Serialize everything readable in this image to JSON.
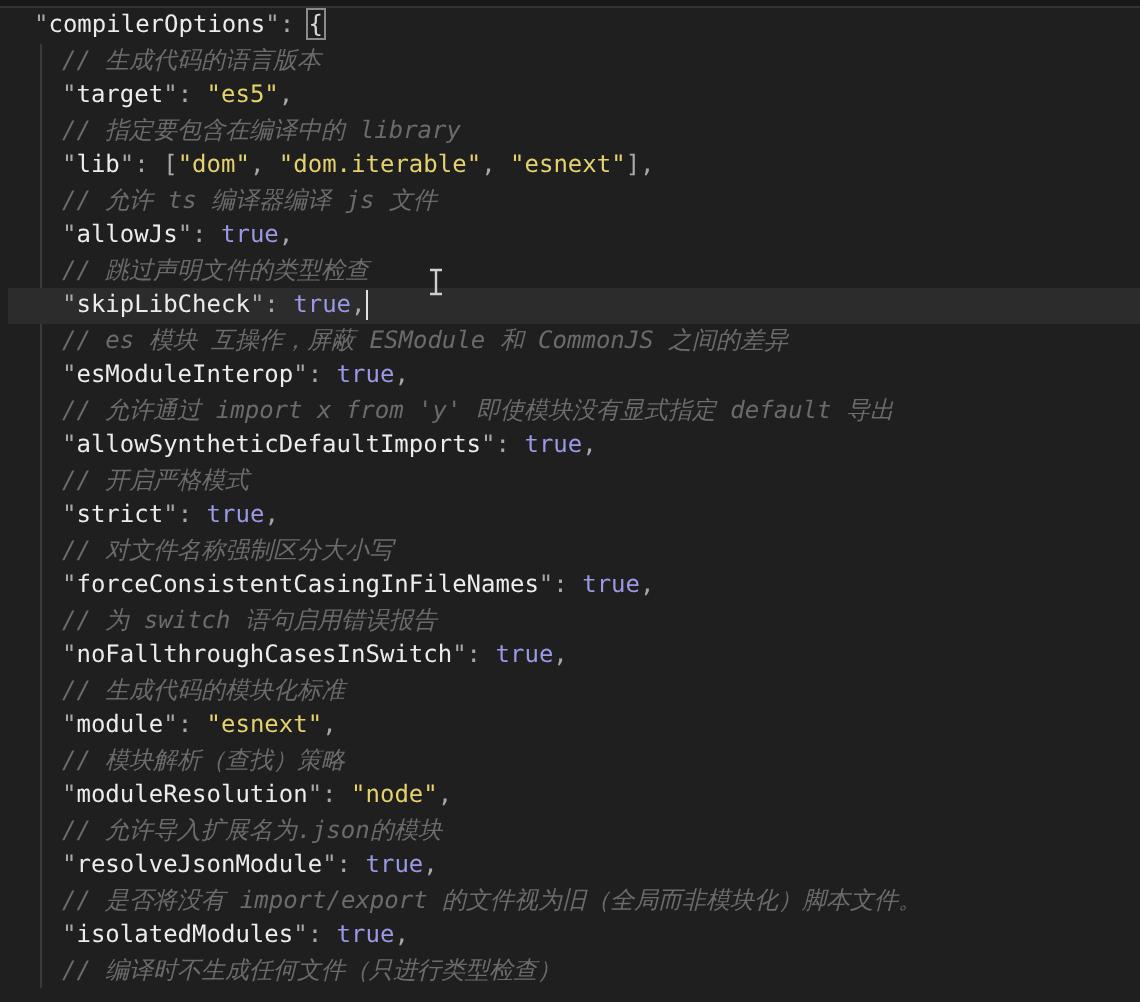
{
  "editor": {
    "root": {
      "cursor": false,
      "segments": [
        {
          "kind": "punct",
          "text": "\""
        },
        {
          "kind": "key",
          "text": "compilerOptions"
        },
        {
          "kind": "punct",
          "text": "\": "
        },
        {
          "kind": "bracket",
          "text": "{"
        }
      ],
      "children": [
        {
          "cursor": false,
          "segments": [
            {
              "kind": "comment",
              "text": "// 生成代码的语言版本"
            }
          ]
        },
        {
          "cursor": false,
          "segments": [
            {
              "kind": "punct",
              "text": "\""
            },
            {
              "kind": "key",
              "text": "target"
            },
            {
              "kind": "punct",
              "text": "\": "
            },
            {
              "kind": "string",
              "text": "\"es5\""
            },
            {
              "kind": "punct",
              "text": ","
            }
          ]
        },
        {
          "cursor": false,
          "segments": [
            {
              "kind": "comment",
              "text": "// 指定要包含在编译中的 library"
            }
          ]
        },
        {
          "cursor": false,
          "segments": [
            {
              "kind": "punct",
              "text": "\""
            },
            {
              "kind": "key",
              "text": "lib"
            },
            {
              "kind": "punct",
              "text": "\": ["
            },
            {
              "kind": "string",
              "text": "\"dom\""
            },
            {
              "kind": "punct",
              "text": ", "
            },
            {
              "kind": "string",
              "text": "\"dom.iterable\""
            },
            {
              "kind": "punct",
              "text": ", "
            },
            {
              "kind": "string",
              "text": "\"esnext\""
            },
            {
              "kind": "punct",
              "text": "],"
            }
          ]
        },
        {
          "cursor": false,
          "segments": [
            {
              "kind": "comment",
              "text": "// 允许 ts 编译器编译 js 文件"
            }
          ]
        },
        {
          "cursor": false,
          "segments": [
            {
              "kind": "punct",
              "text": "\""
            },
            {
              "kind": "key",
              "text": "allowJs"
            },
            {
              "kind": "punct",
              "text": "\": "
            },
            {
              "kind": "keyword",
              "text": "true"
            },
            {
              "kind": "punct",
              "text": ","
            }
          ]
        },
        {
          "cursor": false,
          "segments": [
            {
              "kind": "comment",
              "text": "// 跳过声明文件的类型检查"
            }
          ]
        },
        {
          "cursor": true,
          "segments": [
            {
              "kind": "punct",
              "text": "\""
            },
            {
              "kind": "key",
              "text": "skipLibCheck"
            },
            {
              "kind": "punct",
              "text": "\": "
            },
            {
              "kind": "keyword",
              "text": "true"
            },
            {
              "kind": "punct",
              "text": ","
            }
          ]
        },
        {
          "cursor": false,
          "segments": [
            {
              "kind": "comment",
              "text": "// es 模块 互操作，屏蔽 ESModule 和 CommonJS 之间的差异"
            }
          ]
        },
        {
          "cursor": false,
          "segments": [
            {
              "kind": "punct",
              "text": "\""
            },
            {
              "kind": "key",
              "text": "esModuleInterop"
            },
            {
              "kind": "punct",
              "text": "\": "
            },
            {
              "kind": "keyword",
              "text": "true"
            },
            {
              "kind": "punct",
              "text": ","
            }
          ]
        },
        {
          "cursor": false,
          "segments": [
            {
              "kind": "comment",
              "text": "// 允许通过 import x from 'y' 即使模块没有显式指定 default 导出"
            }
          ]
        },
        {
          "cursor": false,
          "segments": [
            {
              "kind": "punct",
              "text": "\""
            },
            {
              "kind": "key",
              "text": "allowSyntheticDefaultImports"
            },
            {
              "kind": "punct",
              "text": "\": "
            },
            {
              "kind": "keyword",
              "text": "true"
            },
            {
              "kind": "punct",
              "text": ","
            }
          ]
        },
        {
          "cursor": false,
          "segments": [
            {
              "kind": "comment",
              "text": "// 开启严格模式"
            }
          ]
        },
        {
          "cursor": false,
          "segments": [
            {
              "kind": "punct",
              "text": "\""
            },
            {
              "kind": "key",
              "text": "strict"
            },
            {
              "kind": "punct",
              "text": "\": "
            },
            {
              "kind": "keyword",
              "text": "true"
            },
            {
              "kind": "punct",
              "text": ","
            }
          ]
        },
        {
          "cursor": false,
          "segments": [
            {
              "kind": "comment",
              "text": "// 对文件名称强制区分大小写"
            }
          ]
        },
        {
          "cursor": false,
          "segments": [
            {
              "kind": "punct",
              "text": "\""
            },
            {
              "kind": "key",
              "text": "forceConsistentCasingInFileNames"
            },
            {
              "kind": "punct",
              "text": "\": "
            },
            {
              "kind": "keyword",
              "text": "true"
            },
            {
              "kind": "punct",
              "text": ","
            }
          ]
        },
        {
          "cursor": false,
          "segments": [
            {
              "kind": "comment",
              "text": "// 为 switch 语句启用错误报告"
            }
          ]
        },
        {
          "cursor": false,
          "segments": [
            {
              "kind": "punct",
              "text": "\""
            },
            {
              "kind": "key",
              "text": "noFallthroughCasesInSwitch"
            },
            {
              "kind": "punct",
              "text": "\": "
            },
            {
              "kind": "keyword",
              "text": "true"
            },
            {
              "kind": "punct",
              "text": ","
            }
          ]
        },
        {
          "cursor": false,
          "segments": [
            {
              "kind": "comment",
              "text": "// 生成代码的模块化标准"
            }
          ]
        },
        {
          "cursor": false,
          "segments": [
            {
              "kind": "punct",
              "text": "\""
            },
            {
              "kind": "key",
              "text": "module"
            },
            {
              "kind": "punct",
              "text": "\": "
            },
            {
              "kind": "string",
              "text": "\"esnext\""
            },
            {
              "kind": "punct",
              "text": ","
            }
          ]
        },
        {
          "cursor": false,
          "segments": [
            {
              "kind": "comment",
              "text": "// 模块解析（查找）策略"
            }
          ]
        },
        {
          "cursor": false,
          "segments": [
            {
              "kind": "punct",
              "text": "\""
            },
            {
              "kind": "key",
              "text": "moduleResolution"
            },
            {
              "kind": "punct",
              "text": "\": "
            },
            {
              "kind": "string",
              "text": "\"node\""
            },
            {
              "kind": "punct",
              "text": ","
            }
          ]
        },
        {
          "cursor": false,
          "segments": [
            {
              "kind": "comment",
              "text": "// 允许导入扩展名为.json的模块"
            }
          ]
        },
        {
          "cursor": false,
          "segments": [
            {
              "kind": "punct",
              "text": "\""
            },
            {
              "kind": "key",
              "text": "resolveJsonModule"
            },
            {
              "kind": "punct",
              "text": "\": "
            },
            {
              "kind": "keyword",
              "text": "true"
            },
            {
              "kind": "punct",
              "text": ","
            }
          ]
        },
        {
          "cursor": false,
          "segments": [
            {
              "kind": "comment",
              "text": "// 是否将没有 import/export 的文件视为旧（全局而非模块化）脚本文件。"
            }
          ]
        },
        {
          "cursor": false,
          "segments": [
            {
              "kind": "punct",
              "text": "\""
            },
            {
              "kind": "key",
              "text": "isolatedModules"
            },
            {
              "kind": "punct",
              "text": "\": "
            },
            {
              "kind": "keyword",
              "text": "true"
            },
            {
              "kind": "punct",
              "text": ","
            }
          ]
        },
        {
          "cursor": false,
          "segments": [
            {
              "kind": "comment",
              "text": "// 编译时不生成任何文件（只进行类型检查）"
            }
          ]
        }
      ]
    }
  }
}
